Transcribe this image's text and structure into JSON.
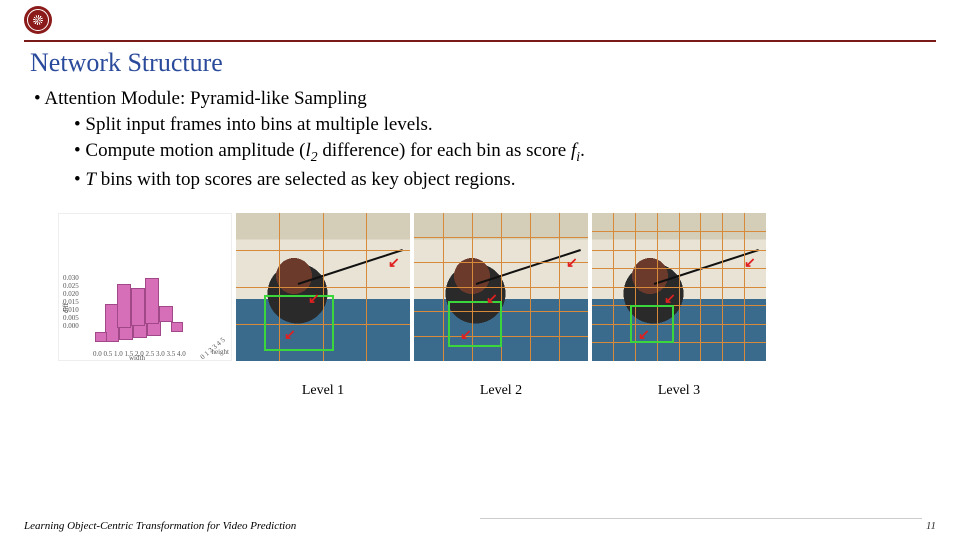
{
  "header": {
    "title": "Network Structure"
  },
  "bullets": {
    "main": "Attention Module: Pyramid-like Sampling",
    "sub1": "Split input frames into bins at multiple levels.",
    "sub2_a": "Compute motion amplitude (",
    "sub2_l": "l",
    "sub2_lsub": "2",
    "sub2_b": " difference) for each bin as score ",
    "sub2_f": "f",
    "sub2_fsub": "i",
    "sub2_c": ".",
    "sub3_a": "T",
    "sub3_b": " bins with top scores are selected as key object regions."
  },
  "figures": {
    "level1": "Level 1",
    "level2": "Level 2",
    "level3": "Level 3"
  },
  "chart_data": {
    "type": "bar",
    "title": "",
    "zlabel": "diff",
    "xlabel": "width",
    "ylabel": "height",
    "x_ticks": [
      0.0,
      0.5,
      1.0,
      1.5,
      2.0,
      2.5,
      3.0,
      3.5,
      4.0
    ],
    "y_ticks": [
      0,
      1,
      2,
      3,
      4,
      5
    ],
    "z_ticks": [
      0.0,
      0.005,
      0.01,
      0.015,
      0.02,
      0.025,
      0.03
    ],
    "grid": {
      "width_bins": 4,
      "height_bins": 5
    },
    "values": [
      [
        0.004,
        0.003,
        0.002,
        0.002,
        0.002
      ],
      [
        0.028,
        0.022,
        0.03,
        0.014,
        0.006
      ],
      [
        0.024,
        0.026,
        0.03,
        0.018,
        0.006
      ],
      [
        0.004,
        0.004,
        0.005,
        0.004,
        0.003
      ]
    ]
  },
  "footer": {
    "left": "Learning Object-Centric Transformation for Video Prediction",
    "page": "11"
  }
}
